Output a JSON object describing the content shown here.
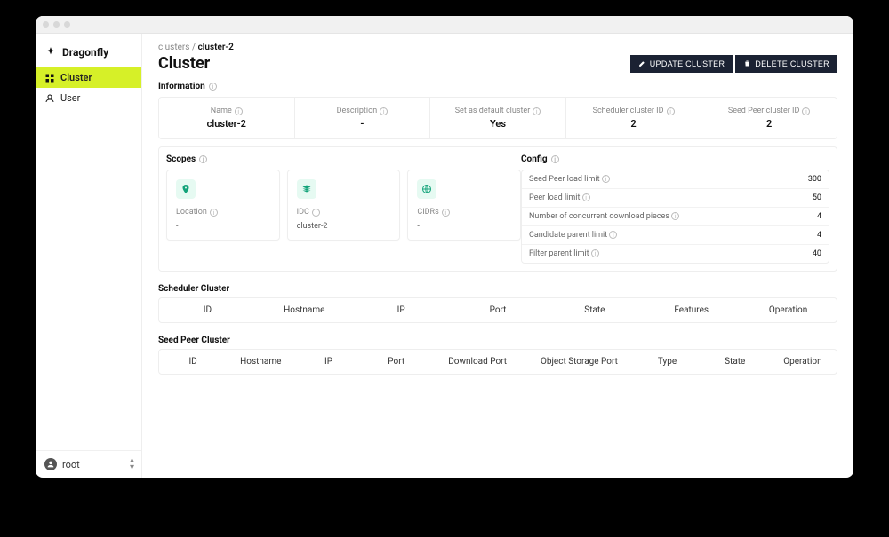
{
  "brand": "Dragonfly",
  "nav": {
    "cluster": "Cluster",
    "user": "User"
  },
  "user": {
    "name": "root"
  },
  "breadcrumb": {
    "root": "clusters",
    "current": "cluster-2"
  },
  "page_title": "Cluster",
  "actions": {
    "update": "UPDATE CLUSTER",
    "delete": "DELETE CLUSTER"
  },
  "information": {
    "label": "Information",
    "items": {
      "name": {
        "label": "Name",
        "value": "cluster-2"
      },
      "desc": {
        "label": "Description",
        "value": "-"
      },
      "def": {
        "label": "Set as default cluster",
        "value": "Yes"
      },
      "sched": {
        "label": "Scheduler cluster ID",
        "value": "2"
      },
      "seed": {
        "label": "Seed Peer cluster ID",
        "value": "2"
      }
    }
  },
  "scopes": {
    "label": "Scopes",
    "cards": {
      "location": {
        "label": "Location",
        "value": "-"
      },
      "idc": {
        "label": "IDC",
        "value": "cluster-2"
      },
      "cidrs": {
        "label": "CIDRs",
        "value": "-"
      }
    }
  },
  "config": {
    "label": "Config",
    "rows": {
      "seed_load": {
        "label": "Seed Peer load limit",
        "value": "300"
      },
      "peer_load": {
        "label": "Peer load limit",
        "value": "50"
      },
      "pieces": {
        "label": "Number of concurrent download pieces",
        "value": "4"
      },
      "cand": {
        "label": "Candidate parent limit",
        "value": "4"
      },
      "filter": {
        "label": "Filter parent limit",
        "value": "40"
      }
    }
  },
  "scheduler_cluster": {
    "label": "Scheduler Cluster",
    "cols": {
      "id": "ID",
      "host": "Hostname",
      "ip": "IP",
      "port": "Port",
      "state": "State",
      "feat": "Features",
      "op": "Operation"
    }
  },
  "seed_peer_cluster": {
    "label": "Seed Peer Cluster",
    "cols": {
      "id": "ID",
      "host": "Hostname",
      "ip": "IP",
      "port": "Port",
      "dport": "Download Port",
      "oport": "Object Storage Port",
      "type": "Type",
      "state": "State",
      "op": "Operation"
    }
  }
}
